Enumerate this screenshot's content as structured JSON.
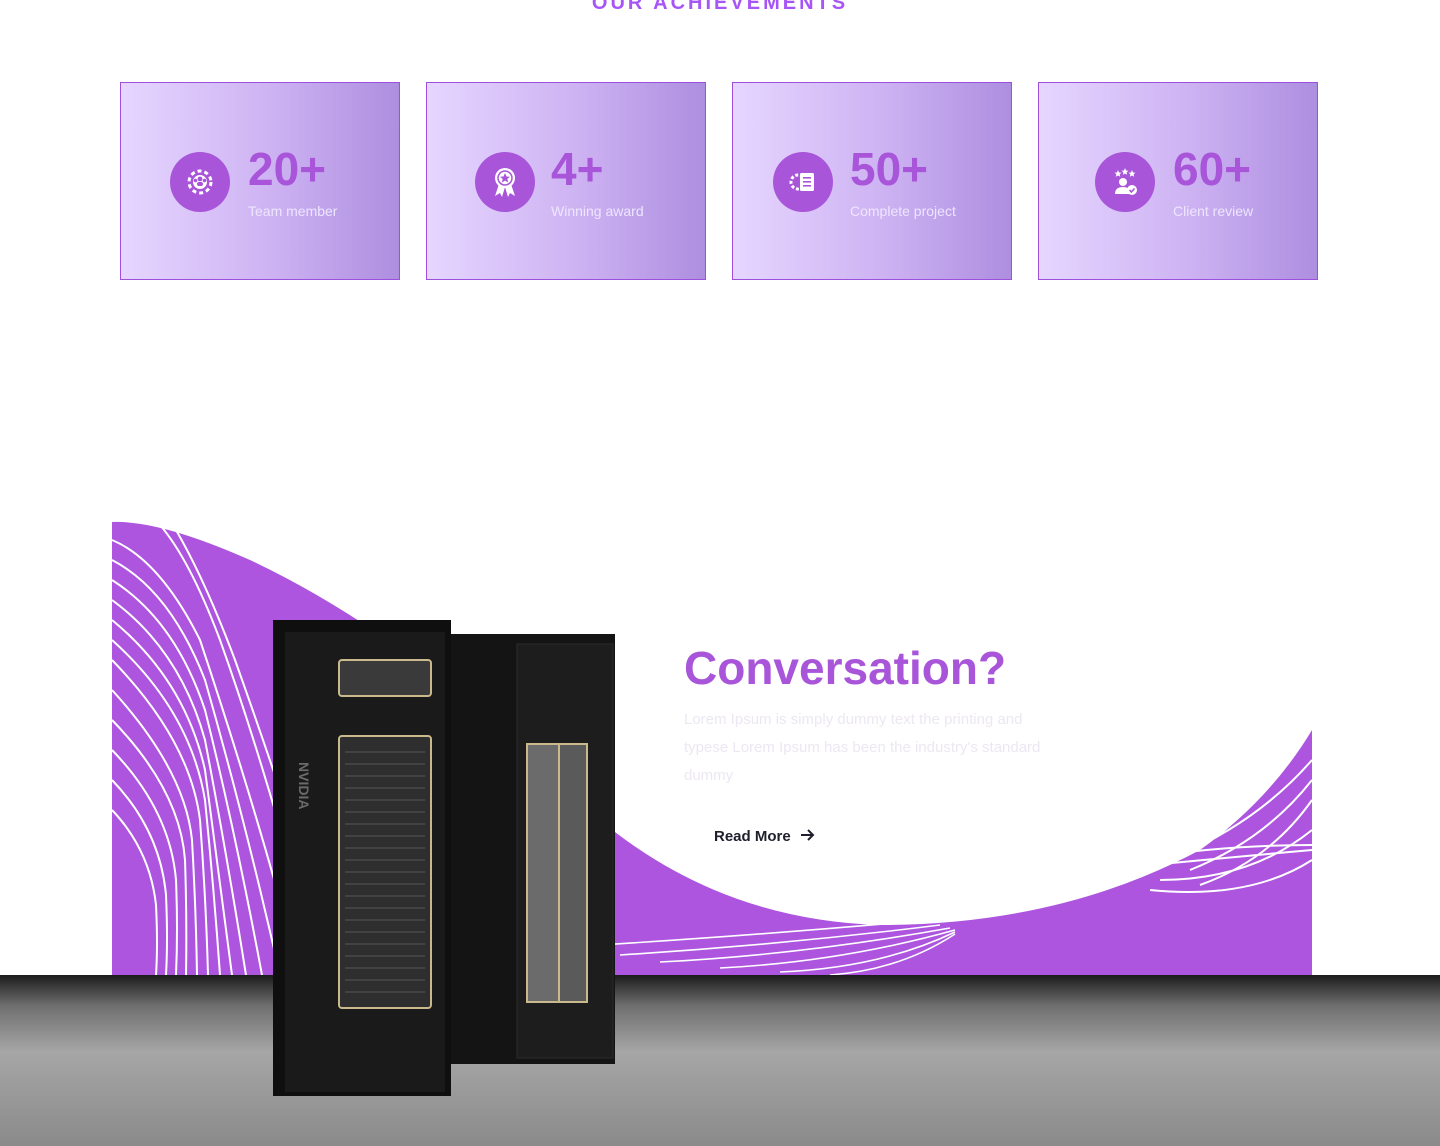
{
  "achievements": {
    "section_label": "OUR ACHIEVEMENTS",
    "items": [
      {
        "value": "20+",
        "label": "Team member",
        "icon": "team-gear-icon"
      },
      {
        "value": "4+",
        "label": "Winning award",
        "icon": "award-ribbon-icon"
      },
      {
        "value": "50+",
        "label": "Complete project",
        "icon": "project-document-icon"
      },
      {
        "value": "60+",
        "label": "Client review",
        "icon": "client-review-icon"
      }
    ]
  },
  "hero": {
    "title": "Conversation?",
    "description": "Lorem Ipsum is simply dummy text the printing and typese Lorem Ipsum has been the industry's standard dummy",
    "read_more_label": "Read More",
    "server_brand": "NVIDIA"
  },
  "colors": {
    "accent": "#a855d9",
    "card_gradient_start": "#e6d6ff",
    "card_gradient_end": "#ad8ee0"
  }
}
